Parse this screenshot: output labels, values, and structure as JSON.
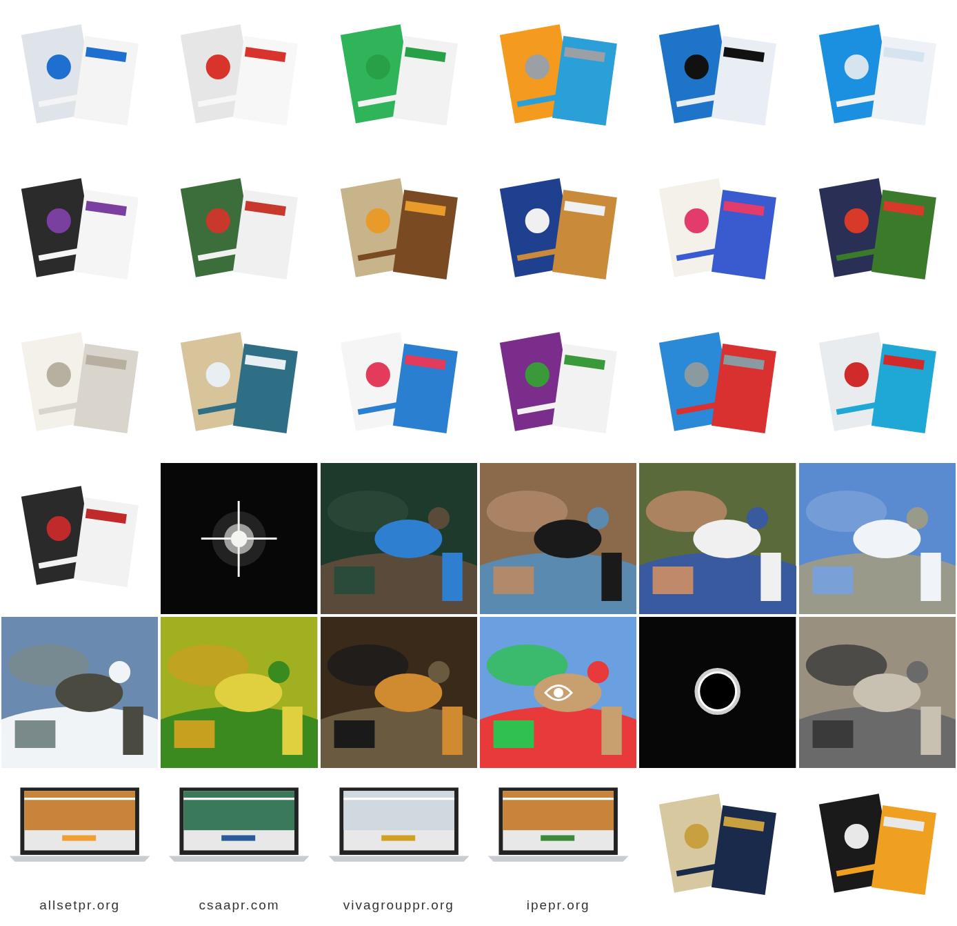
{
  "gallery": [
    {
      "kind": "picture"
    },
    {
      "kind": "picture"
    },
    {
      "kind": "picture"
    },
    {
      "kind": "picture"
    },
    {
      "kind": "picture"
    },
    {
      "kind": "picture"
    },
    {
      "kind": "picture"
    },
    {
      "kind": "picture"
    },
    {
      "kind": "picture"
    },
    {
      "kind": "picture"
    },
    {
      "kind": "picture"
    },
    {
      "kind": "picture"
    },
    {
      "kind": "picture"
    },
    {
      "kind": "picture"
    },
    {
      "kind": "picture"
    },
    {
      "kind": "picture"
    },
    {
      "kind": "picture"
    },
    {
      "kind": "picture"
    },
    {
      "kind": "picture"
    },
    {
      "kind": "picture"
    },
    {
      "kind": "picture"
    },
    {
      "kind": "picture"
    },
    {
      "kind": "picture"
    },
    {
      "kind": "picture"
    },
    {
      "kind": "picture"
    },
    {
      "kind": "picture"
    },
    {
      "kind": "picture"
    },
    {
      "kind": "picture",
      "hovered": true
    },
    {
      "kind": "picture"
    },
    {
      "kind": "picture"
    },
    {
      "kind": "laptop",
      "caption": "allsetpr.org"
    },
    {
      "kind": "laptop",
      "caption": "csaapr.com"
    },
    {
      "kind": "laptop",
      "caption": "vivagrouppr.org"
    },
    {
      "kind": "laptop",
      "caption": "ipepr.org"
    },
    {
      "kind": "picture"
    },
    {
      "kind": "picture"
    }
  ]
}
